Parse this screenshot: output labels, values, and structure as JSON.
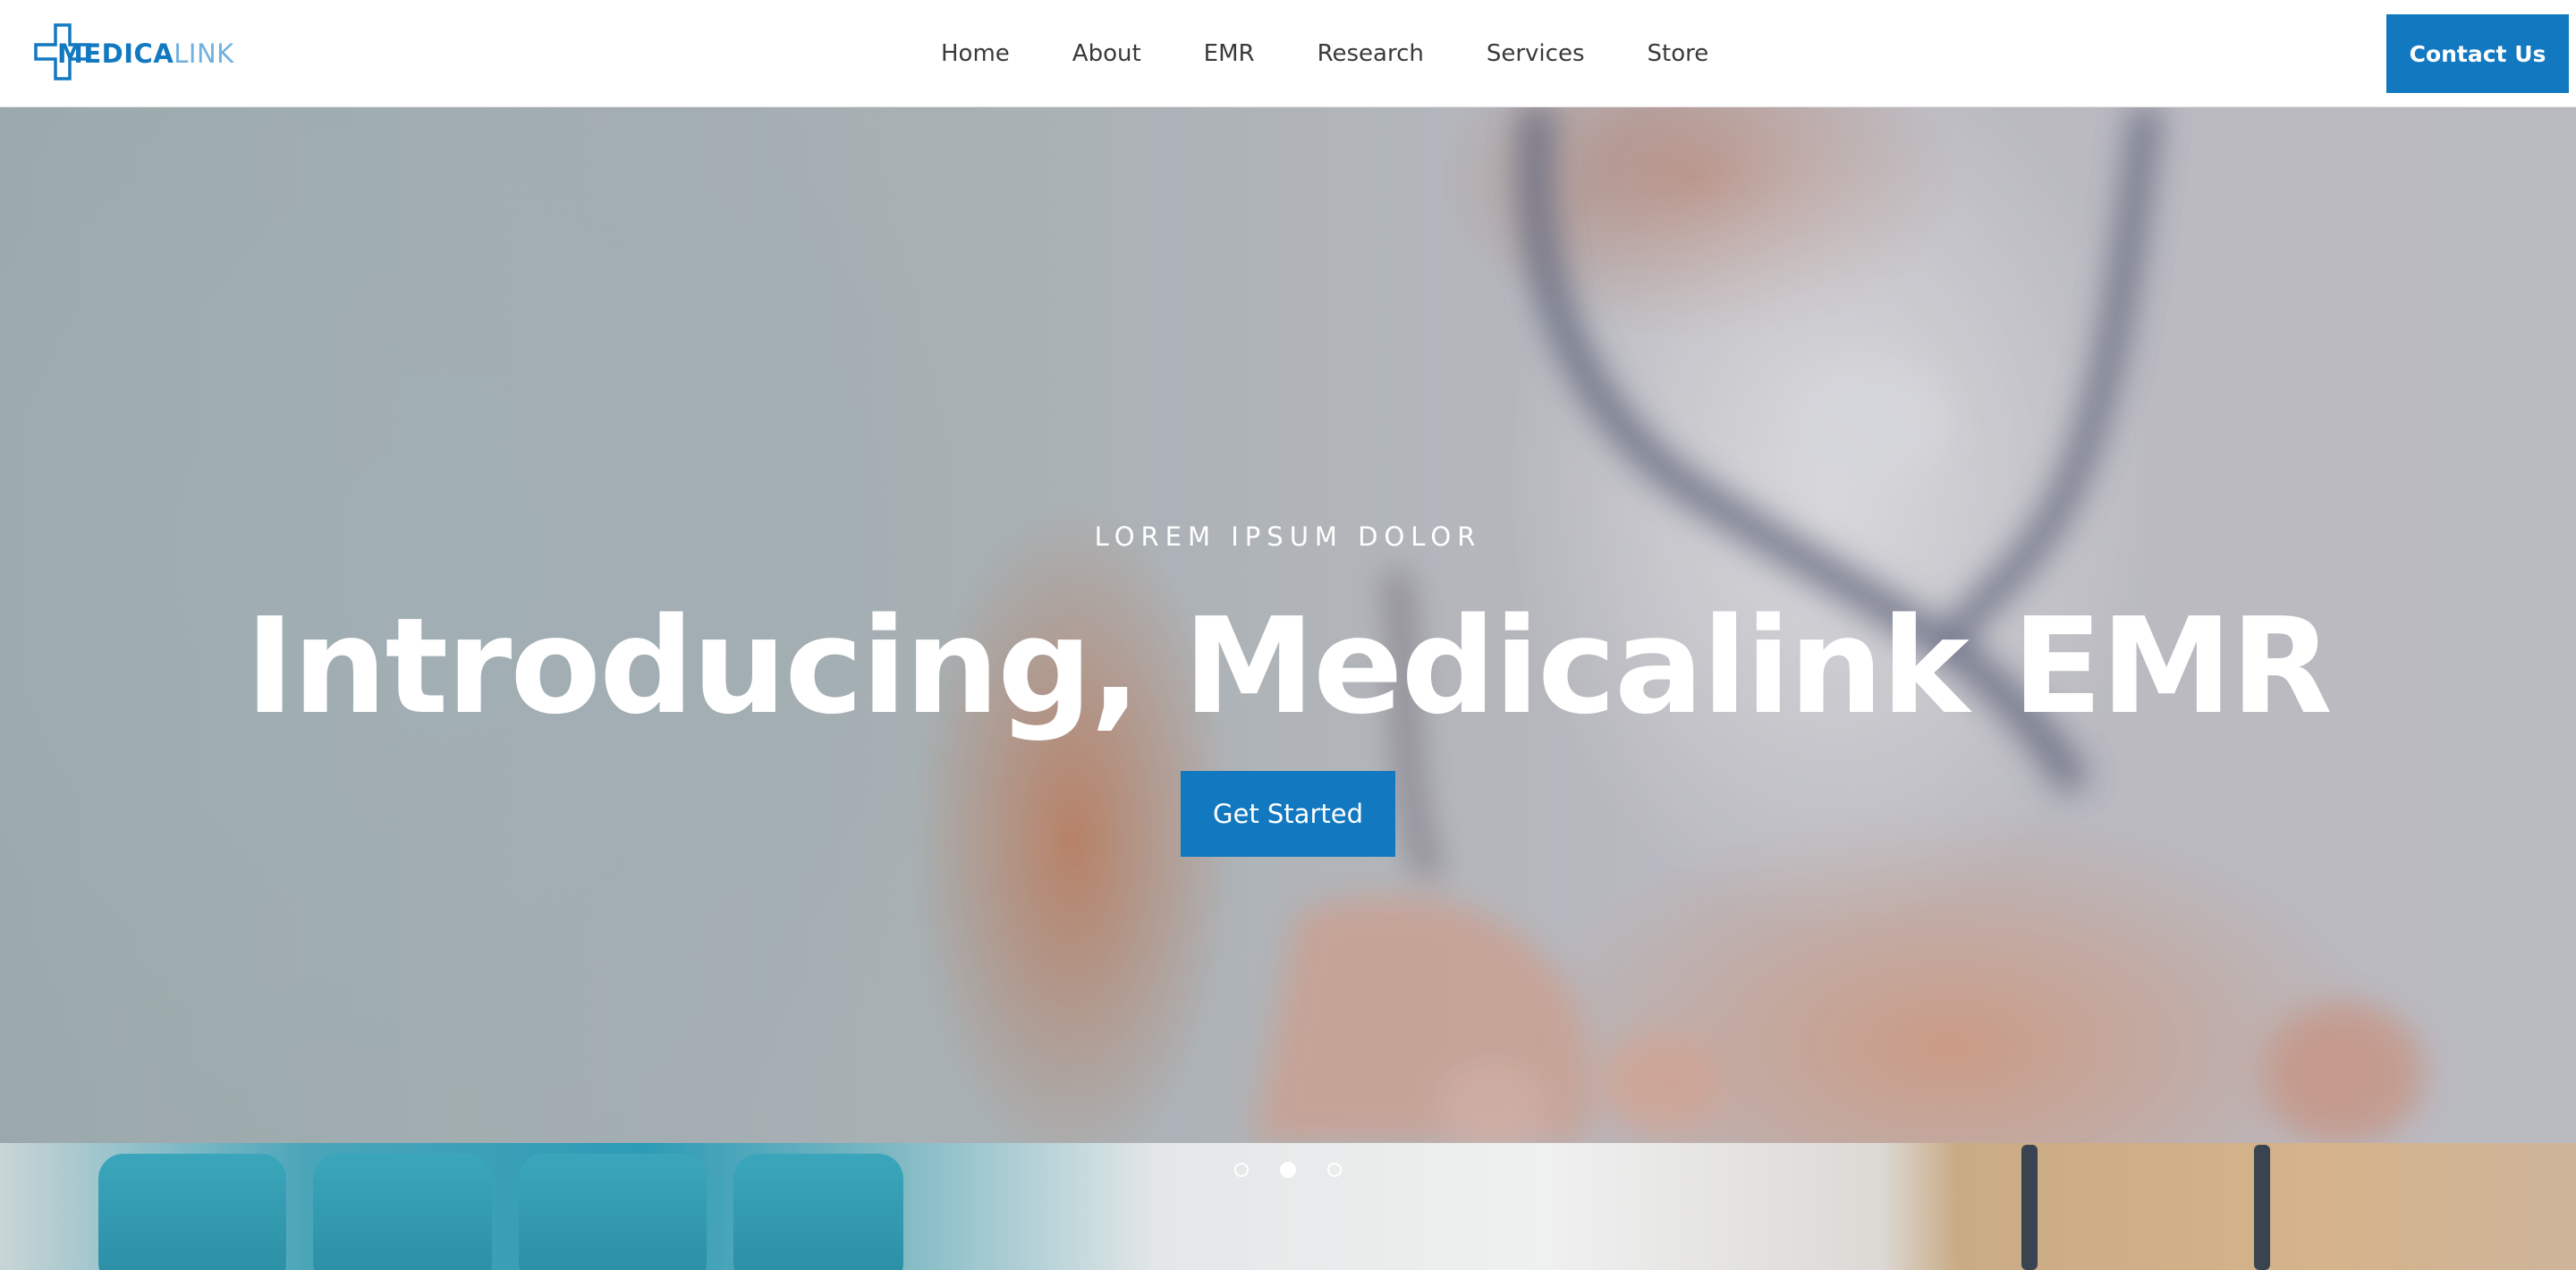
{
  "header": {
    "logo": {
      "part_bold": "MEDICA",
      "part_light": "LINK"
    },
    "nav": [
      {
        "label": "Home"
      },
      {
        "label": "About"
      },
      {
        "label": "EMR"
      },
      {
        "label": "Research"
      },
      {
        "label": "Services"
      },
      {
        "label": "Store"
      }
    ],
    "contact_label": "Contact Us"
  },
  "hero": {
    "eyebrow": "LOREM IPSUM DOLOR",
    "title": "Introducing, Medicalink EMR",
    "cta_label": "Get Started"
  },
  "carousel": {
    "slide_count": 3,
    "active_index": 1
  },
  "colors": {
    "brand_blue": "#1279c1",
    "logo_light": "#6fb0de",
    "nav_text": "#3a3a3a"
  },
  "icons": {
    "logo": "medical-cross-icon",
    "carousel_dot": "carousel-dot-icon"
  }
}
